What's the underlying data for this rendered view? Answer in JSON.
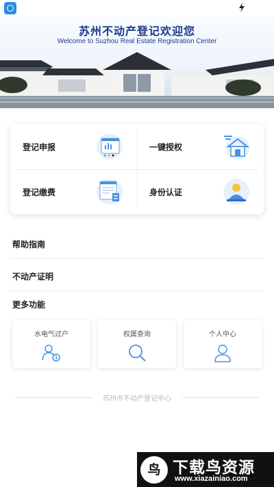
{
  "banner": {
    "title": "苏州不动产登记欢迎您",
    "subtitle": "Welcome to Suzhou Real Estate Registration Center"
  },
  "services": [
    {
      "label": "登记申报",
      "icon": "registration-form-icon"
    },
    {
      "label": "一键授权",
      "icon": "house-authorize-icon"
    },
    {
      "label": "登记缴费",
      "icon": "payment-document-icon"
    },
    {
      "label": "身份认证",
      "icon": "identity-verify-icon"
    }
  ],
  "menu": [
    {
      "label": "帮助指南"
    },
    {
      "label": "不动产证明"
    }
  ],
  "more": {
    "title": "更多功能",
    "items": [
      {
        "label": "水电气过户",
        "icon": "utility-transfer-icon"
      },
      {
        "label": "权属查询",
        "icon": "search-icon"
      },
      {
        "label": "个人中心",
        "icon": "user-icon"
      }
    ]
  },
  "footer": {
    "text": "苏州市不动产登记中心"
  },
  "watermark": {
    "title": "下载鸟资源",
    "url": "www.xiazainiao.com",
    "logo_glyph": "鸟"
  },
  "colors": {
    "banner_title": "#1d3a8a",
    "icon_blue": "#4a90e2",
    "footer_text": "#b9b9b9"
  }
}
